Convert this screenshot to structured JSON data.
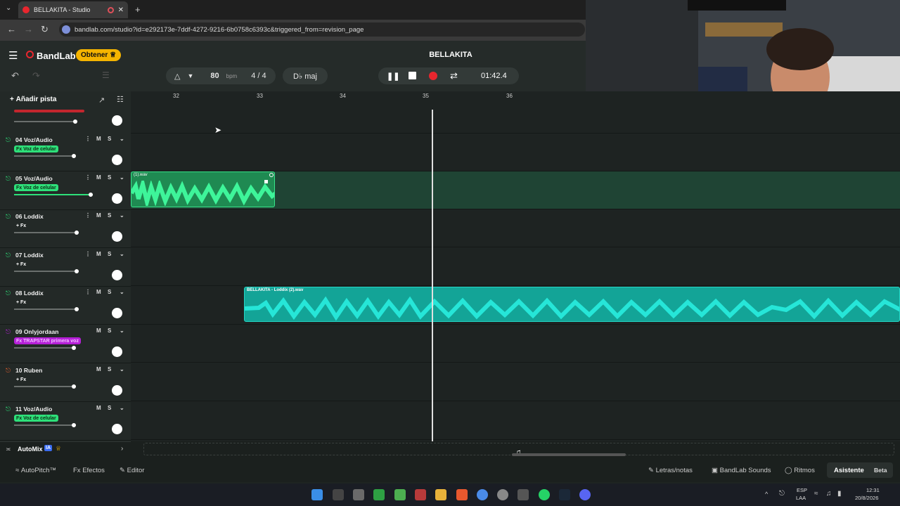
{
  "browser": {
    "tab_title": "BELLAKITA - Studio",
    "new_tab": "+",
    "url": "bandlab.com/studio?id=e292173e-7ddf-4272-9216-6b0758c6393c&triggered_from=revision_page"
  },
  "app": {
    "logo": "BandLab",
    "get_button": "Obtener",
    "project_title": "BELLAKITA",
    "bpm_value": "80",
    "bpm_unit": "bpm",
    "time_signature": "4 / 4",
    "key": "D♭ maj",
    "time_display": "01:42.4",
    "add_track": "Añadir pista"
  },
  "ruler": [
    "32",
    "33",
    "34",
    "35",
    "36"
  ],
  "tracks": [
    {
      "name": "04 Voz/Audio",
      "fx": "Fx Voz de celular",
      "mute": "M",
      "solo": "S"
    },
    {
      "name": "05 Voz/Audio",
      "fx": "Fx Voz de celular",
      "mute": "M",
      "solo": "S"
    },
    {
      "name": "06 Loddix",
      "fx": "+ Fx",
      "mute": "M",
      "solo": "S"
    },
    {
      "name": "07 Loddix",
      "fx": "+ Fx",
      "mute": "M",
      "solo": "S"
    },
    {
      "name": "08 Loddix",
      "fx": "+ Fx",
      "mute": "M",
      "solo": "S"
    },
    {
      "name": "09 Onlyjordaan",
      "fx": "Fx TRAPSTAR primera voz",
      "mute": "M",
      "solo": "S"
    },
    {
      "name": "10 Ruben",
      "fx": "+ Fx",
      "mute": "M",
      "solo": "S"
    },
    {
      "name": "11 Voz/Audio",
      "fx": "Fx Voz de celular",
      "mute": "M",
      "solo": "S"
    }
  ],
  "regions": [
    {
      "label": "(1).wav"
    },
    {
      "label": "BELLAKITA - Loddix (2).wav"
    }
  ],
  "automix": {
    "label": "AutoMix",
    "badge": "IA"
  },
  "bottom_tools": {
    "autopitch": "AutoPitch™",
    "effects": "Efectos",
    "editor": "Editor",
    "lyrics": "Letras/notas",
    "sounds": "BandLab Sounds",
    "rhythms": "Ritmos",
    "assistant": "Asistente",
    "beta": "Beta"
  },
  "taskbar": {
    "lang": "ESP",
    "lang2": "LAA",
    "time": "12:31",
    "date": "20/8/2026"
  },
  "colors": {
    "accent_green": "#2ee07a",
    "teal_region": "#19c7b8",
    "record_red": "#e8262e",
    "get_yellow": "#f5b400",
    "purple_fx": "#b620d8"
  }
}
